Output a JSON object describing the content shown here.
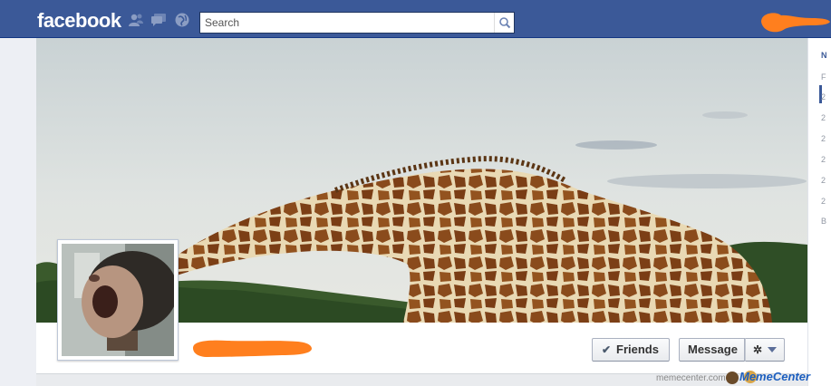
{
  "header": {
    "logo": "facebook",
    "search": {
      "placeholder": "Search",
      "value": ""
    },
    "jewels": [
      "friend-requests-icon",
      "messages-icon",
      "notifications-icon"
    ],
    "colors": {
      "bar": "#3b5998",
      "accent": "#ff7f1e"
    }
  },
  "profile": {
    "actions": {
      "friends_label": "Friends",
      "message_label": "Message",
      "settings_icon": "gear-icon"
    }
  },
  "timeline_rail": {
    "items": [
      "N",
      "F",
      "2",
      "2",
      "2",
      "2",
      "2",
      "2",
      "B"
    ]
  },
  "watermark": {
    "site": "memecenter.com",
    "logo": "MemeCenter"
  }
}
